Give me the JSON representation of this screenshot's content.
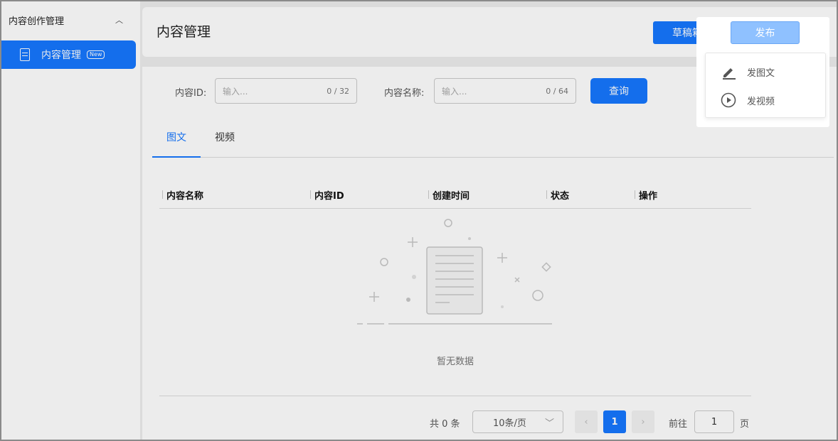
{
  "sidebar": {
    "group_label": "内容创作管理",
    "item_label": "内容管理",
    "item_badge": "New"
  },
  "header": {
    "title": "内容管理",
    "draft_button": "草稿箱",
    "publish_button": "发布"
  },
  "publish_menu": {
    "items": [
      {
        "label": "发图文",
        "icon": "pencil-icon"
      },
      {
        "label": "发视频",
        "icon": "play-circle-icon"
      }
    ]
  },
  "filters": {
    "id_label": "内容ID:",
    "id_placeholder": "输入...",
    "id_counter": "0 / 32",
    "name_label": "内容名称:",
    "name_placeholder": "输入...",
    "name_counter": "0 / 64",
    "query_button": "查询"
  },
  "tabs": [
    "图文",
    "视频"
  ],
  "table": {
    "columns": [
      "内容名称",
      "内容ID",
      "创建时间",
      "状态",
      "操作"
    ],
    "empty_text": "暂无数据"
  },
  "pagination": {
    "total": "共 0 条",
    "page_size": "10条/页",
    "current_page": "1",
    "goto_label": "前往",
    "goto_value": "1",
    "goto_unit": "页"
  },
  "colors": {
    "primary": "#1677ff",
    "publish_highlight": "#8fc1ff"
  }
}
